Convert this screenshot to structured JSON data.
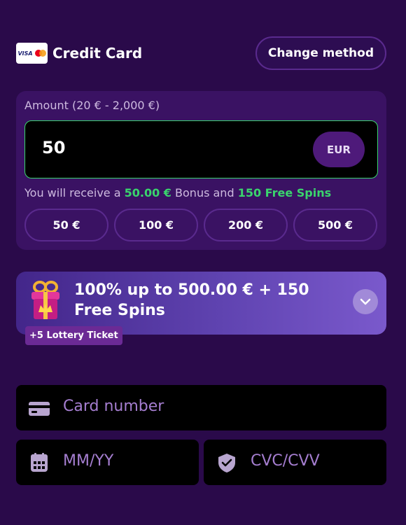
{
  "payment_method": {
    "logo_text": "VISA",
    "title": "Credit Card",
    "change_button": "Change method"
  },
  "amount": {
    "label": "Amount (20 € - 2,000 €)",
    "value": "50",
    "currency": "EUR",
    "receive_prefix": "You will receive a",
    "bonus_amount": "50.00 €",
    "receive_middle": "Bonus and",
    "free_spins": "150 Free Spins",
    "presets": [
      "50 €",
      "100 €",
      "200 €",
      "500 €"
    ]
  },
  "bonus": {
    "title": "100% up to 500.00 € + 150 Free Spins",
    "lottery": "+5 Lottery Ticket",
    "icon": "gift-icon"
  },
  "card_form": {
    "card_number_placeholder": "Card number",
    "expiry_placeholder": "MM/YY",
    "cvc_placeholder": "CVC/CVV"
  },
  "colors": {
    "background": "#2a0a4a",
    "panel": "#3a1263",
    "accent_green": "#3ad56d",
    "placeholder": "#a57ed0"
  }
}
